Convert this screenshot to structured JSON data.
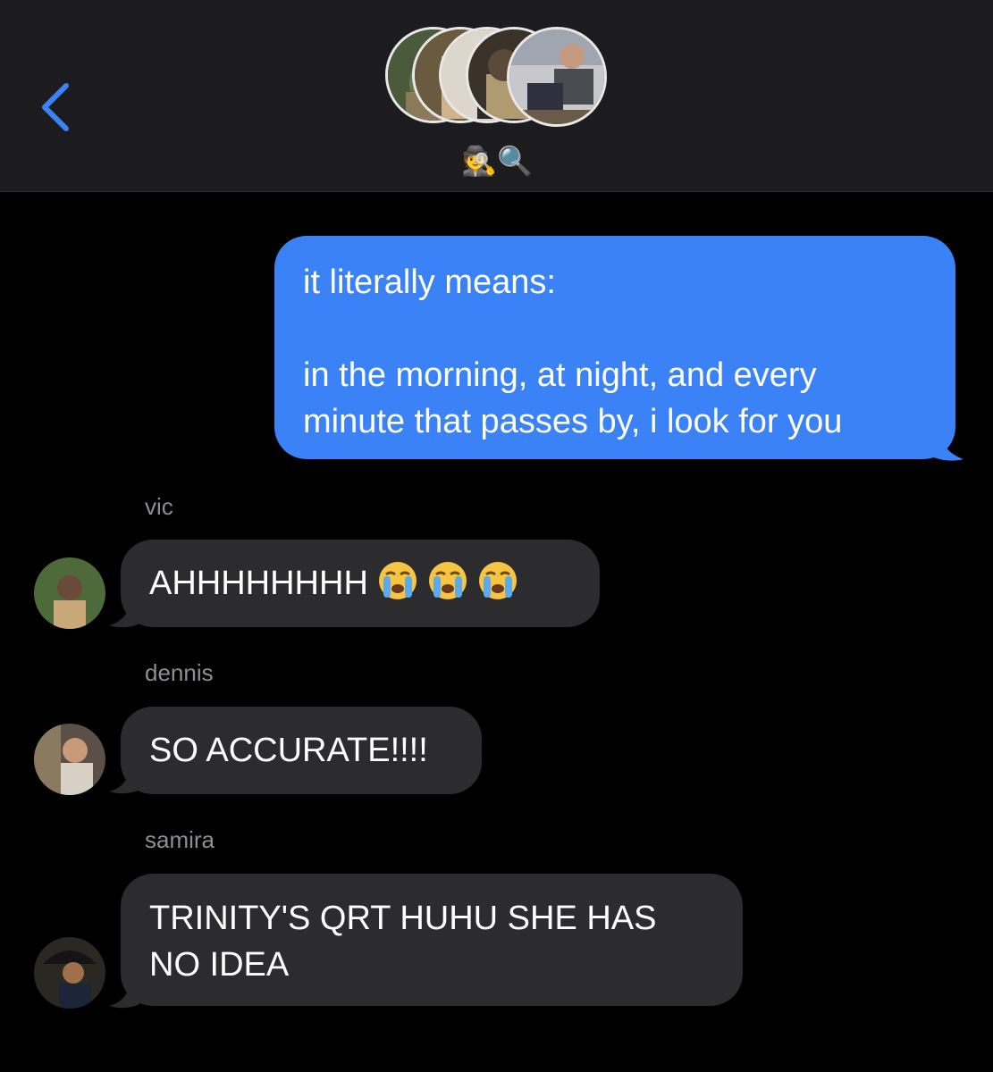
{
  "header": {
    "back_icon": "chevron-left-icon",
    "group_emoji": "🕵️🔍",
    "accent_color": "#3a82f6"
  },
  "messages": [
    {
      "direction": "outgoing",
      "lines": [
        "it literally means:",
        "",
        "in the morning, at night, and every",
        "minute that passes by, i look for you"
      ],
      "color": "#3a82f6"
    },
    {
      "direction": "incoming",
      "sender": "vic",
      "text": "AHHHHHHHH",
      "emoji": [
        "loudly-crying-face",
        "loudly-crying-face",
        "loudly-crying-face"
      ],
      "color": "#2c2c2e"
    },
    {
      "direction": "incoming",
      "sender": "dennis",
      "text": "SO ACCURATE!!!!",
      "color": "#2c2c2e"
    },
    {
      "direction": "incoming",
      "sender": "samira",
      "lines": [
        "TRINITY'S QRT HUHU SHE HAS",
        "NO IDEA"
      ],
      "color": "#2c2c2e"
    }
  ]
}
